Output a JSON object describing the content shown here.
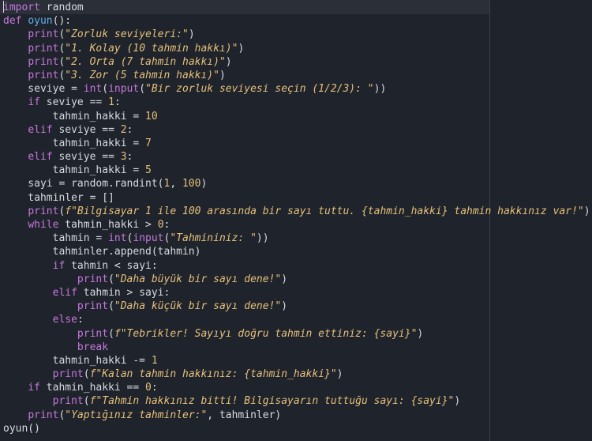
{
  "editor": {
    "language": "python",
    "cursor_line": 1,
    "colors": {
      "background": "#1f232b",
      "current_line": "#2a2f38",
      "keyword": "#c678dd",
      "function_name": "#61afef",
      "string": "#e5c07b",
      "number": "#e5c07b",
      "text": "#d7dae0",
      "ruler": "#3a404b"
    },
    "lines": [
      [
        {
          "t": "kw",
          "v": "import"
        },
        {
          "t": "id",
          "v": " random"
        }
      ],
      [
        {
          "t": "kw",
          "v": "def "
        },
        {
          "t": "fn",
          "v": "oyun"
        },
        {
          "t": "id",
          "v": "():"
        }
      ],
      [
        {
          "t": "id",
          "v": "    "
        },
        {
          "t": "bi",
          "v": "print"
        },
        {
          "t": "id",
          "v": "("
        },
        {
          "t": "str",
          "v": "\"Zorluk seviyeleri:\""
        },
        {
          "t": "id",
          "v": ")"
        }
      ],
      [
        {
          "t": "id",
          "v": "    "
        },
        {
          "t": "bi",
          "v": "print"
        },
        {
          "t": "id",
          "v": "("
        },
        {
          "t": "str",
          "v": "\"1. Kolay (10 tahmin hakkı)\""
        },
        {
          "t": "id",
          "v": ")"
        }
      ],
      [
        {
          "t": "id",
          "v": "    "
        },
        {
          "t": "bi",
          "v": "print"
        },
        {
          "t": "id",
          "v": "("
        },
        {
          "t": "str",
          "v": "\"2. Orta (7 tahmin hakkı)\""
        },
        {
          "t": "id",
          "v": ")"
        }
      ],
      [
        {
          "t": "id",
          "v": "    "
        },
        {
          "t": "bi",
          "v": "print"
        },
        {
          "t": "id",
          "v": "("
        },
        {
          "t": "str",
          "v": "\"3. Zor (5 tahmin hakkı)\""
        },
        {
          "t": "id",
          "v": ")"
        }
      ],
      [
        {
          "t": "id",
          "v": "    seviye = "
        },
        {
          "t": "bi",
          "v": "int"
        },
        {
          "t": "id",
          "v": "("
        },
        {
          "t": "bi",
          "v": "input"
        },
        {
          "t": "id",
          "v": "("
        },
        {
          "t": "str",
          "v": "\"Bir zorluk seviyesi seçin (1/2/3): \""
        },
        {
          "t": "id",
          "v": "))"
        }
      ],
      [
        {
          "t": "id",
          "v": "    "
        },
        {
          "t": "kw",
          "v": "if"
        },
        {
          "t": "id",
          "v": " seviye == "
        },
        {
          "t": "num",
          "v": "1"
        },
        {
          "t": "id",
          "v": ":"
        }
      ],
      [
        {
          "t": "id",
          "v": "        tahmin_hakki = "
        },
        {
          "t": "num",
          "v": "10"
        }
      ],
      [
        {
          "t": "id",
          "v": "    "
        },
        {
          "t": "kw",
          "v": "elif"
        },
        {
          "t": "id",
          "v": " seviye == "
        },
        {
          "t": "num",
          "v": "2"
        },
        {
          "t": "id",
          "v": ":"
        }
      ],
      [
        {
          "t": "id",
          "v": "        tahmin_hakki = "
        },
        {
          "t": "num",
          "v": "7"
        }
      ],
      [
        {
          "t": "id",
          "v": "    "
        },
        {
          "t": "kw",
          "v": "elif"
        },
        {
          "t": "id",
          "v": " seviye == "
        },
        {
          "t": "num",
          "v": "3"
        },
        {
          "t": "id",
          "v": ":"
        }
      ],
      [
        {
          "t": "id",
          "v": "        tahmin_hakki = "
        },
        {
          "t": "num",
          "v": "5"
        }
      ],
      [
        {
          "t": "id",
          "v": "    sayi = random.randint("
        },
        {
          "t": "num",
          "v": "1"
        },
        {
          "t": "id",
          "v": ", "
        },
        {
          "t": "num",
          "v": "100"
        },
        {
          "t": "id",
          "v": ")"
        }
      ],
      [
        {
          "t": "id",
          "v": "    tahminler = []"
        }
      ],
      [
        {
          "t": "id",
          "v": "    "
        },
        {
          "t": "bi",
          "v": "print"
        },
        {
          "t": "id",
          "v": "("
        },
        {
          "t": "str",
          "v": "f\"Bilgisayar 1 ile 100 arasında bir sayı tuttu. {tahmin_hakki} tahmin hakkınız var!\""
        },
        {
          "t": "id",
          "v": ")"
        }
      ],
      [
        {
          "t": "id",
          "v": "    "
        },
        {
          "t": "kw",
          "v": "while"
        },
        {
          "t": "id",
          "v": " tahmin_hakki > "
        },
        {
          "t": "num",
          "v": "0"
        },
        {
          "t": "id",
          "v": ":"
        }
      ],
      [
        {
          "t": "id",
          "v": "        tahmin = "
        },
        {
          "t": "bi",
          "v": "int"
        },
        {
          "t": "id",
          "v": "("
        },
        {
          "t": "bi",
          "v": "input"
        },
        {
          "t": "id",
          "v": "("
        },
        {
          "t": "str",
          "v": "\"Tahmininiz: \""
        },
        {
          "t": "id",
          "v": "))"
        }
      ],
      [
        {
          "t": "id",
          "v": "        tahminler.append(tahmin)"
        }
      ],
      [
        {
          "t": "id",
          "v": "        "
        },
        {
          "t": "kw",
          "v": "if"
        },
        {
          "t": "id",
          "v": " tahmin < sayi:"
        }
      ],
      [
        {
          "t": "id",
          "v": "            "
        },
        {
          "t": "bi",
          "v": "print"
        },
        {
          "t": "id",
          "v": "("
        },
        {
          "t": "str",
          "v": "\"Daha büyük bir sayı dene!\""
        },
        {
          "t": "id",
          "v": ")"
        }
      ],
      [
        {
          "t": "id",
          "v": "        "
        },
        {
          "t": "kw",
          "v": "elif"
        },
        {
          "t": "id",
          "v": " tahmin > sayi:"
        }
      ],
      [
        {
          "t": "id",
          "v": "            "
        },
        {
          "t": "bi",
          "v": "print"
        },
        {
          "t": "id",
          "v": "("
        },
        {
          "t": "str",
          "v": "\"Daha küçük bir sayı dene!\""
        },
        {
          "t": "id",
          "v": ")"
        }
      ],
      [
        {
          "t": "id",
          "v": "        "
        },
        {
          "t": "kw",
          "v": "else"
        },
        {
          "t": "id",
          "v": ":"
        }
      ],
      [
        {
          "t": "id",
          "v": "            "
        },
        {
          "t": "bi",
          "v": "print"
        },
        {
          "t": "id",
          "v": "("
        },
        {
          "t": "str",
          "v": "f\"Tebrikler! Sayıyı doğru tahmin ettiniz: {sayi}\""
        },
        {
          "t": "id",
          "v": ")"
        }
      ],
      [
        {
          "t": "id",
          "v": "            "
        },
        {
          "t": "kw",
          "v": "break"
        }
      ],
      [
        {
          "t": "id",
          "v": "        tahmin_hakki -= "
        },
        {
          "t": "num",
          "v": "1"
        }
      ],
      [
        {
          "t": "id",
          "v": "        "
        },
        {
          "t": "bi",
          "v": "print"
        },
        {
          "t": "id",
          "v": "("
        },
        {
          "t": "str",
          "v": "f\"Kalan tahmin hakkınız: {tahmin_hakki}\""
        },
        {
          "t": "id",
          "v": ")"
        }
      ],
      [
        {
          "t": "id",
          "v": "    "
        },
        {
          "t": "kw",
          "v": "if"
        },
        {
          "t": "id",
          "v": " tahmin_hakki == "
        },
        {
          "t": "num",
          "v": "0"
        },
        {
          "t": "id",
          "v": ":"
        }
      ],
      [
        {
          "t": "id",
          "v": "        "
        },
        {
          "t": "bi",
          "v": "print"
        },
        {
          "t": "id",
          "v": "("
        },
        {
          "t": "str",
          "v": "f\"Tahmin hakkınız bitti! Bilgisayarın tuttuğu sayı: {sayi}\""
        },
        {
          "t": "id",
          "v": ")"
        }
      ],
      [
        {
          "t": "id",
          "v": "    "
        },
        {
          "t": "bi",
          "v": "print"
        },
        {
          "t": "id",
          "v": "("
        },
        {
          "t": "str",
          "v": "\"Yaptığınız tahminler:\""
        },
        {
          "t": "id",
          "v": ", tahminler)"
        }
      ],
      [
        {
          "t": "id",
          "v": "oyun()"
        }
      ]
    ]
  }
}
